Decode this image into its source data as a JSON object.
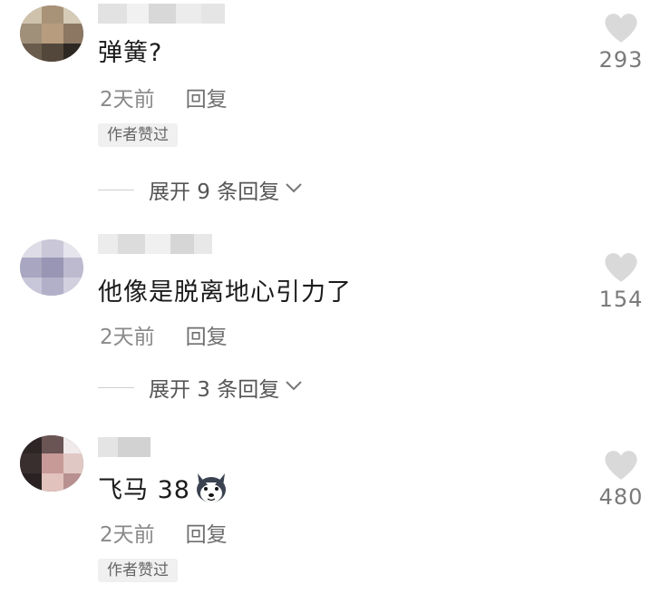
{
  "comments": [
    {
      "text": "弹簧?",
      "time": "2天前",
      "reply_label": "回复",
      "badge": "作者赞过",
      "expand_label": "展开 9 条回复",
      "likes": "293"
    },
    {
      "text": "他像是脱离地心引力了",
      "time": "2天前",
      "reply_label": "回复",
      "expand_label": "展开 3 条回复",
      "likes": "154"
    },
    {
      "text": "飞马 38",
      "emoji": "husky-dog-emoji",
      "time": "2天前",
      "reply_label": "回复",
      "badge": "作者赞过",
      "likes": "480"
    }
  ],
  "icons": {
    "like": "heart-icon",
    "expand": "chevron-down-icon"
  },
  "colors": {
    "text": "#1b1b1b",
    "meta": "#8a8a8a",
    "heart": "#d9d9d9",
    "badge_bg": "#f0f0f0"
  }
}
